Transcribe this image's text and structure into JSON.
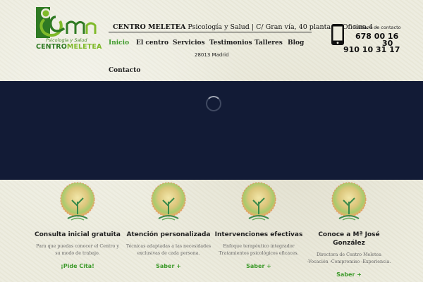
{
  "brand": {
    "tagline": "Psicología y Salud",
    "name_part1": "CENTRO",
    "name_part2": "MELETEA",
    "colors": {
      "dark_green": "#2f7a23",
      "light_green": "#7fba2a",
      "accent": "#3d9a2b",
      "hero_bg": "#121b36"
    }
  },
  "header": {
    "title_bold": "CENTRO MELETEA",
    "title_rest": " Psicología y Salud | C/ Gran vía, 40 planta 7ª Oficina.4 -",
    "address_line2": "28013 Madrid"
  },
  "nav": {
    "items": [
      {
        "label": "Inicio",
        "active": true
      },
      {
        "label": "El centro"
      },
      {
        "label": "Servicios"
      },
      {
        "label": "Testimonios"
      },
      {
        "label": "Talleres"
      },
      {
        "label": "Blog"
      },
      {
        "label": "Contacto"
      }
    ]
  },
  "contact": {
    "icon": "smartphone-icon",
    "caption": "Teléfono de contacto",
    "phone1_part1": "678 00 16",
    "phone1_part2": "30",
    "phone2": "910 10 31 17"
  },
  "hero": {
    "loading_icon": "spinner-icon"
  },
  "features": [
    {
      "title": "Consulta inicial gratuita",
      "desc_line1": "Para que puedas conocer el Centro y",
      "desc_line2": "su modo de trabajo.",
      "cta": "¡Pide Cita!"
    },
    {
      "title": "Atención personalizada",
      "desc_line1": "Técnicas  adaptadas a las necesidades",
      "desc_line2": "exclusivas de cada persona.",
      "cta": "Saber +"
    },
    {
      "title": "Intervenciones efectivas",
      "desc_line1": "Enfoque terapéutico integrador",
      "desc_line2": "Tratamientos psicológicos eficaces.",
      "cta": "Saber +"
    },
    {
      "title_line1": "Conoce a Mª José",
      "title_line2": "González",
      "desc_line1": "Directora de Centro Meletea",
      "desc_line2": "-Vocación -Compromiso -Experiencia.",
      "cta": "Saber +"
    }
  ]
}
